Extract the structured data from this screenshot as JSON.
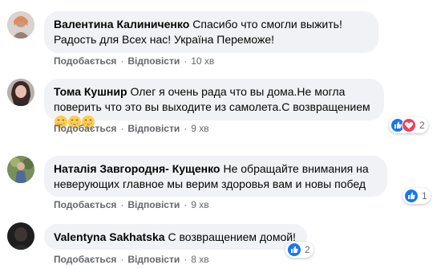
{
  "comments": [
    {
      "author": "Валентина Калиниченко",
      "text": "Спасибо что смогли выжить! Радость для Всех нас! Україна Переможе!",
      "like_label": "Подобається",
      "reply_label": "Відповісти",
      "time": "10 хв",
      "reaction_count": ""
    },
    {
      "author": "Тома Кушнир",
      "text": "Олег я очень рада что вы дома.Не могла поверить что это вы выходите из самолета.С возвращением",
      "like_label": "Подобається",
      "reply_label": "Відповісти",
      "time": "9 хв",
      "reaction_count": "2",
      "reactions": [
        "like-icon",
        "love-icon"
      ],
      "emojis": [
        "grinning-face-icon",
        "grinning-face-icon",
        "grinning-face-icon"
      ]
    },
    {
      "author": "Наталія Завгородня- Кущенко",
      "text": "Не обращайте внимания на неверующих главное мы верим здоровья вам и новы побед",
      "like_label": "Подобається",
      "reply_label": "Відповісти",
      "time": "9 хв",
      "reaction_count": "1",
      "reactions": [
        "like-icon"
      ]
    },
    {
      "author": "Valentyna Sakhatska",
      "text": "С возвращением домой!",
      "like_label": "Подобається",
      "reply_label": "Відповісти",
      "time": "8 хв",
      "reaction_count": "2",
      "reactions": [
        "like-icon"
      ]
    }
  ],
  "separator": "·",
  "colors": {
    "bubble": "#f0f2f5",
    "meta_text": "#65676b",
    "like_blue": "#1877f2",
    "love_red": "#f33e58"
  }
}
